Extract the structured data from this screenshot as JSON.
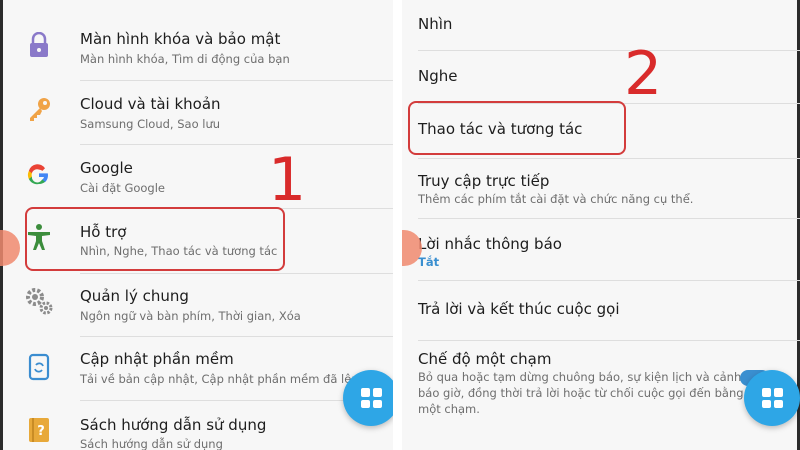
{
  "left": {
    "items": [
      {
        "title": "Màn hình khóa và bảo mật",
        "subtitle": "Màn hình khóa, Tìm di động của bạn"
      },
      {
        "title": "Cloud và tài khoản",
        "subtitle": "Samsung Cloud, Sao lưu"
      },
      {
        "title": "Google",
        "subtitle": "Cài đặt Google"
      },
      {
        "title": "Hỗ trợ",
        "subtitle": "Nhìn, Nghe, Thao tác và tương tác"
      },
      {
        "title": "Quản lý chung",
        "subtitle": "Ngôn ngữ và bàn phím, Thời gian, Xóa"
      },
      {
        "title": "Cập nhật phần mềm",
        "subtitle": "Tải về bản cập nhật, Cập nhật phần mềm đã lên lịch"
      },
      {
        "title": "Sách hướng dẫn sử dụng",
        "subtitle": "Sách hướng dẫn sử dụng"
      }
    ],
    "step_number": "1"
  },
  "right": {
    "items": [
      {
        "title": "Nhìn"
      },
      {
        "title": "Nghe"
      },
      {
        "title": "Thao tác và tương tác"
      },
      {
        "title": "Truy cập trực tiếp",
        "subtitle": "Thêm các phím tắt cài đặt và chức năng cụ thể."
      },
      {
        "title": "Lời nhắc thông báo",
        "status": "Tắt"
      },
      {
        "title": "Trả lời và kết thúc cuộc gọi"
      },
      {
        "title": "Chế độ một chạm",
        "desc": [
          "Bỏ qua hoặc tạm dừng chuông báo, sự kiện lịch và cảnh",
          "báo giờ, đồng thời trả lời hoặc từ chối cuộc gọi đến bằng",
          "một chạm."
        ]
      }
    ],
    "step_number": "2"
  },
  "colors": {
    "highlight": "#d33c3c",
    "step_number": "#d92b2b",
    "fab": "#2ea6e6",
    "status_accent": "#3a8fd0",
    "accessibility_icon": "#3c8d3c"
  },
  "icons": [
    "lock-icon",
    "key-icon",
    "google-icon",
    "accessibility-icon",
    "gears-icon",
    "software-update-icon",
    "manual-book-icon",
    "apps-grid-icon"
  ]
}
